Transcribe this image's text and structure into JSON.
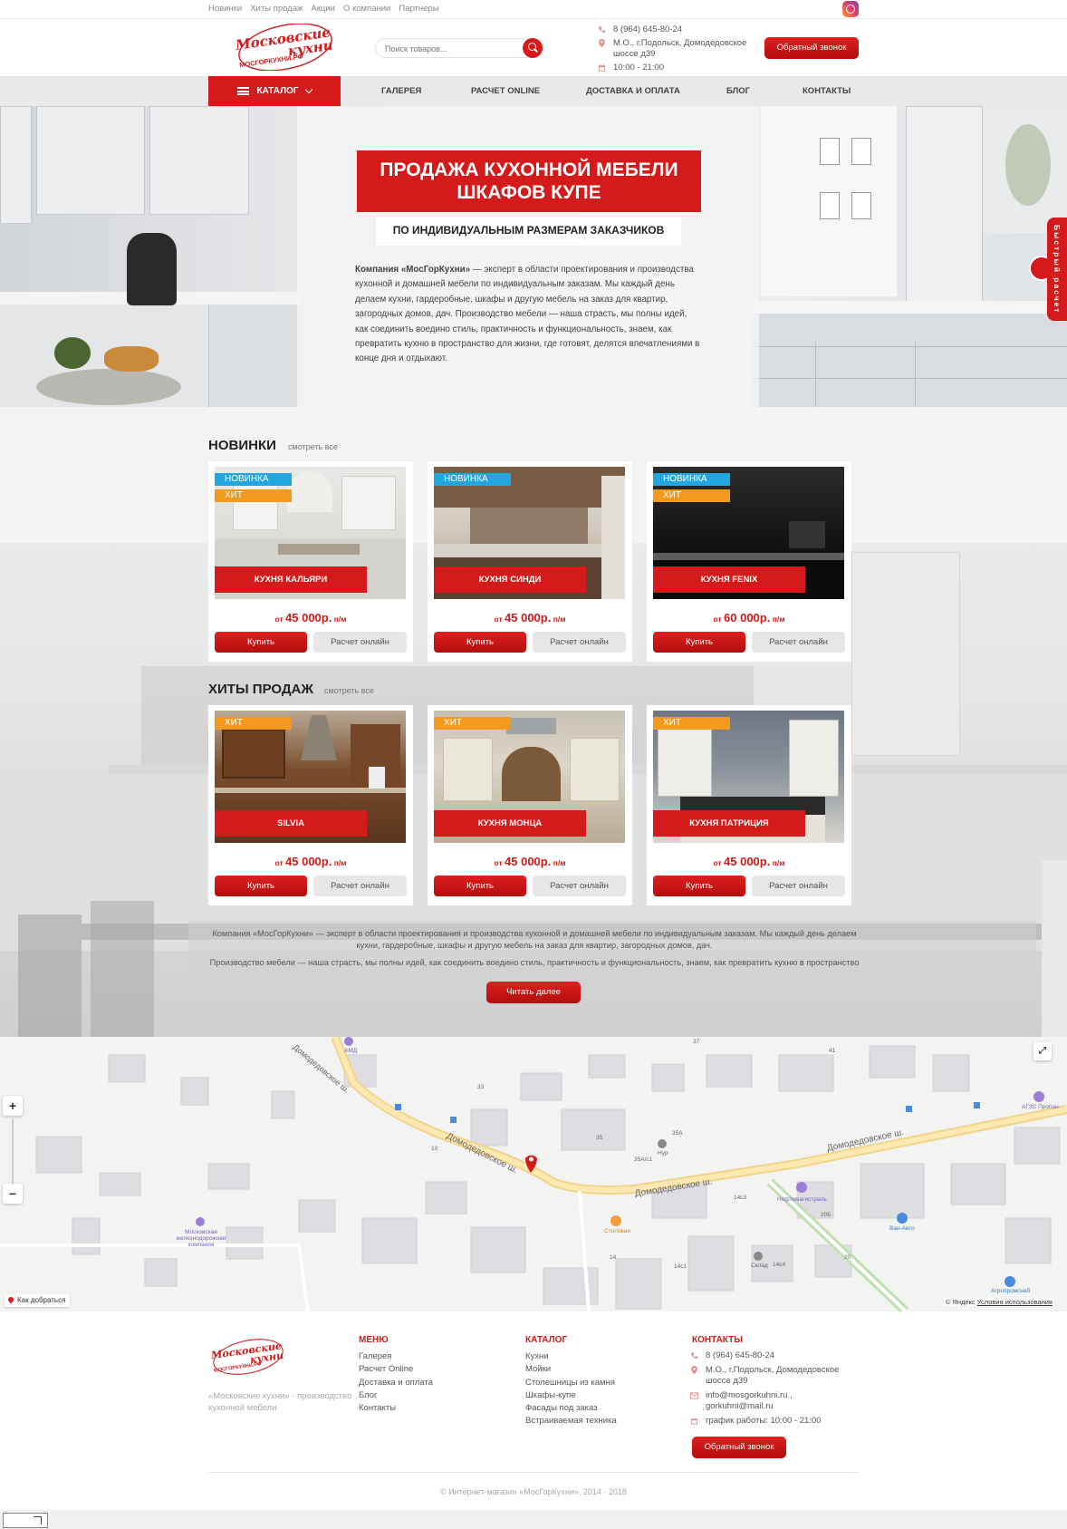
{
  "topnav": [
    "Новинки",
    "Хиты продаж",
    "Акции",
    "О компании",
    "Партнеры"
  ],
  "icons": {
    "instagram": "instagram-icon",
    "search": "search-icon",
    "phone": "phone-icon",
    "location": "location-pin-icon",
    "clock": "calendar-icon",
    "mail": "mail-icon"
  },
  "colors": {
    "brand_red": "#d41a1a",
    "tag_new": "#21a6df",
    "tag_hit": "#f39a1e"
  },
  "header": {
    "logo_line1": "Московские",
    "logo_line2": "кухни",
    "logo_domain": "МОСГОРКУХНИ.РФ",
    "search_placeholder": "Поиск товаров...",
    "phone": "8 (964) 645-80-24",
    "address_line1": "М.О., г.Подольск, Домодедовское",
    "address_line2": "шоссе д39",
    "hours": "10:00 - 21:00",
    "callback": "Обратный звонок"
  },
  "menu": {
    "catalog": "КАТАЛОГ",
    "items": [
      "ГАЛЕРЕЯ",
      "РАСЧЕТ ONLINE",
      "ДОСТАВКА И ОПЛАТА",
      "БЛОГ",
      "КОНТАКТЫ"
    ]
  },
  "hero": {
    "title_line1": "ПРОДАЖА КУХОННОЙ МЕБЕЛИ",
    "title_line2": "ШКАФОВ КУПЕ",
    "subtitle": "ПО ИНДИВИДУАЛЬНЫМ РАЗМЕРАМ ЗАКАЗЧИКОВ",
    "text_bold": "Компания «МосГорКухни»",
    "text": " — эксперт в области проектирования и производства кухонной и домашней мебели по индивидуальным заказам. Мы каждый день делаем кухни, гардеробные, шкафы и другую мебель на заказ для квартир, загородных домов, дач. Производство мебели — наша страсть, мы полны идей, как соединить воедино стиль, практичность и функциональность, знаем, как превратить кухню в пространство для жизни, где готовят, делятся впечатлениями в конце дня и отдыхают.",
    "quick_calc": "Быстрый расчет"
  },
  "novelties": {
    "title": "НОВИНКИ",
    "link": "смотреть все",
    "cards": [
      {
        "name": "КУХНЯ КАЛЬЯРИ",
        "price_prefix": "от",
        "price": "45 000р.",
        "price_unit": "п/м",
        "tag_new": "НОВИНКА",
        "tag_hit": "ХИТ",
        "buy": "Купить",
        "calc": "Расчет онлайн"
      },
      {
        "name": "КУХНЯ СИНДИ",
        "price_prefix": "от",
        "price": "45 000р.",
        "price_unit": "п/м",
        "tag_new": "НОВИНКА",
        "tag_hit": "",
        "buy": "Купить",
        "calc": "Расчет онлайн"
      },
      {
        "name": "КУХНЯ FENIX",
        "price_prefix": "от",
        "price": "60 000р.",
        "price_unit": "п/м",
        "tag_new": "НОВИНКА",
        "tag_hit": "ХИТ",
        "buy": "Купить",
        "calc": "Расчет онлайн"
      }
    ]
  },
  "bestsellers": {
    "title": "ХИТЫ ПРОДАЖ",
    "link": "смотреть все",
    "cards": [
      {
        "name": "SILVIA",
        "price_prefix": "от",
        "price": "45 000р.",
        "price_unit": "п/м",
        "tag_hit": "ХИТ",
        "buy": "Купить",
        "calc": "Расчет онлайн"
      },
      {
        "name": "КУХНЯ МОНЦА",
        "price_prefix": "от",
        "price": "45 000р.",
        "price_unit": "п/м",
        "tag_hit": "ХИТ",
        "buy": "Купить",
        "calc": "Расчет онлайн"
      },
      {
        "name": "КУХНЯ ПАТРИЦИЯ",
        "price_prefix": "от",
        "price": "45 000р.",
        "price_unit": "п/м",
        "tag_hit": "ХИТ",
        "buy": "Купить",
        "calc": "Расчет онлайн"
      }
    ]
  },
  "about": {
    "line1": "Компания «МосГорКухни» — эксперт в области проектирования и производства кухонной и домашней мебели по индивидуальным заказам. Мы каждый день делаем кухни, гардеробные, шкафы и другую мебель на заказ для квартир, загородных домов, дач.",
    "line2": "Производство мебели — наша страсть, мы полны идей, как соединить воедино стиль, практичность и функциональность, знаем, как превратить кухню в пространство",
    "read_more": "Читать далее"
  },
  "map": {
    "zoom_in": "+",
    "zoom_out": "−",
    "how_to_get": "Как добраться",
    "copyright": "© Яндекс",
    "terms": "Условия использования",
    "labels": [
      "Домодедовское ш.",
      "Домодедовское ш.",
      "Домодедовское ш.",
      "Домодедовское ш.",
      "Московская железнодорожная компания",
      "АМД",
      "Нефтемагистраль",
      "Столовая",
      "Ван-Авто",
      "АГЗС Пропан",
      "Агропромснаб",
      "Склад",
      "Нур",
      "35А",
      "35А/с1",
      "37",
      "41",
      "33",
      "35",
      "10",
      "14",
      "14с1",
      "14с3",
      "14с4",
      "20",
      "20Б",
      "1"
    ]
  },
  "footer": {
    "desc": "«Московские кухни» - производство кухонной мебели",
    "menu_title": "МЕНЮ",
    "menu": [
      "Галерея",
      "Расчет Online",
      "Доставка и оплата",
      "Блог",
      "Контакты"
    ],
    "catalog_title": "КАТАЛОГ",
    "catalog": [
      "Кухни",
      "Мойки",
      "Столешницы из камня",
      "Шкафы-купе",
      "Фасады под заказ",
      "Встраиваемая техника"
    ],
    "contacts_title": "КОНТАКТЫ",
    "phone": "8 (964) 645-80-24",
    "address_line1": "М.О., г.Подольск, Домодедовское",
    "address_line2": "шоссе д39",
    "email_line1": "info@mosgorkuhni.ru ,",
    "email_line2": "gorkuhni@mail.ru",
    "hours": "график работы: 10:00 - 21:00",
    "callback": "Обратный звонок",
    "copyright": "© Интернет-магазин «МосГорКухни», 2014 - 2018"
  }
}
